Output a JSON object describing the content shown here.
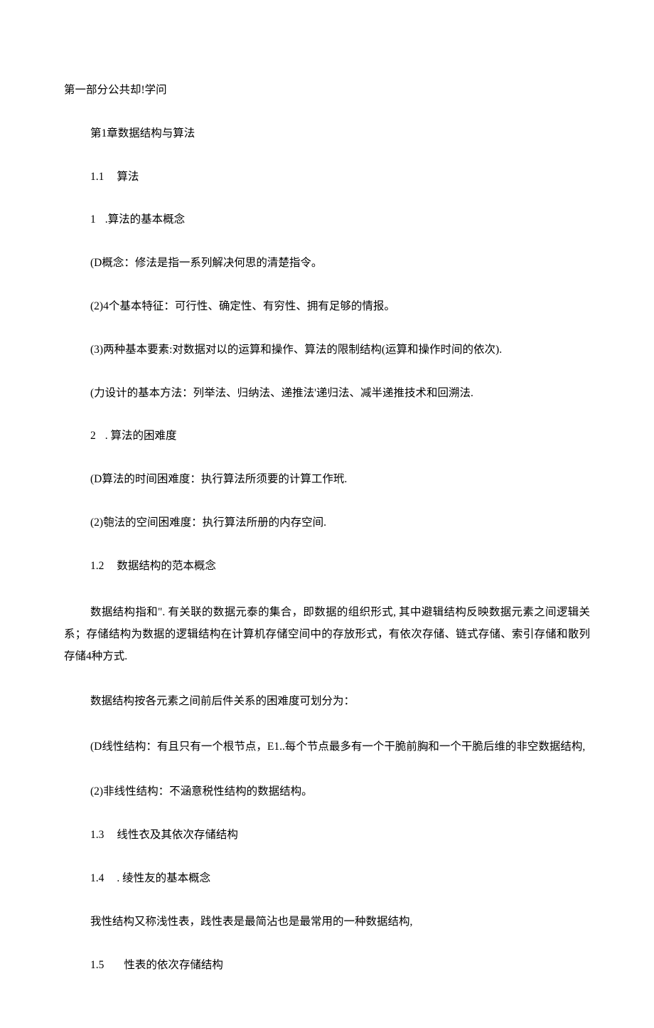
{
  "part_title": "第一部分公共却!学问",
  "chapter_title": "第1章数据结构与算法",
  "s11": {
    "num": "1.1",
    "title": "算法"
  },
  "sub1": {
    "num": "1",
    "title": ".算法的基本概念"
  },
  "p1": "(D概念：修法是指一系列解决何思的清楚指令。",
  "p2": "(2)4个基本特征：可行性、确定性、有穷性、拥有足够的情报。",
  "p3": "(3)两种基本要素:对数据对以的运算和操作、算法的限制结构(运算和操作时间的依次).",
  "p4": "(力设计的基本方法：列举法、归纳法、递推法'递归法、减半递推技术和回溯法.",
  "sub2": {
    "num": "2",
    "title": ". 算法的困难度"
  },
  "p5": "(D算法的时间困难度：执行算法所须要的计算工作玳.",
  "p6": "(2)匏法的空间困难度：执行算法所册的内存空间.",
  "s12": {
    "num": "1.2",
    "title": "数据结构的范本概念"
  },
  "p7": "数据结构指和\". 有关联的数据元泰的集合，即数据的组织形式, 其中避辑结构反映数据元素之间逻辑关系；存储结构为数据的逻辑结构在计算机存储空间中的存放形式，有依次存储、链式存储、索引存储和散列存储4种方式.",
  "p8": "数据结构按各元素之间前后件关系的困难度可划分为：",
  "p9": "(D线性结构：有且只有一个根节点，E1..每个节点最多有一个干脆前胸和一个干脆后维的非空数据结构,",
  "p10": "(2)非线性结构：不涵意税性结构的数据结构。",
  "s13": {
    "num": "1.3",
    "title": "线性衣及其依次存储结构"
  },
  "s14": {
    "num": "1.4",
    "title": ". 绫性友的基本概念"
  },
  "p11": "我性结构又称浅性表，践性表是最简沾也是最常用的一种数据结构,",
  "s15": {
    "num": "1.5",
    "title": "性表的依次存储结构"
  }
}
